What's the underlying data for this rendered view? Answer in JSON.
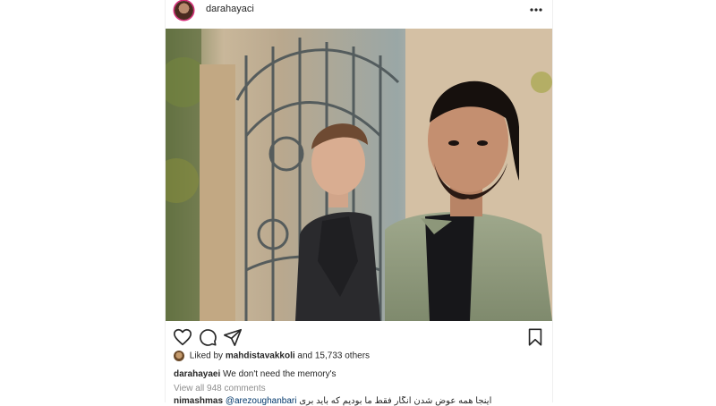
{
  "post": {
    "username": "darahayaci",
    "more_icon": "more-horizontal-icon",
    "likes": {
      "prefix": "Liked by",
      "liker": "mahdistavakkoli",
      "suffix": "and 15,733 others"
    },
    "caption": {
      "author": "darahayaei",
      "text": "We don't need the memory's"
    },
    "view_comments": "View all 948 comments",
    "comment": {
      "author": "nimashmas",
      "mention": "@arezoughanbari",
      "text": "اینجا همه عوض شدن انگار فقط ما بودیم که باید بری"
    },
    "icons": {
      "like": "heart-icon",
      "comment": "comment-icon",
      "share": "share-icon",
      "save": "bookmark-icon"
    }
  }
}
